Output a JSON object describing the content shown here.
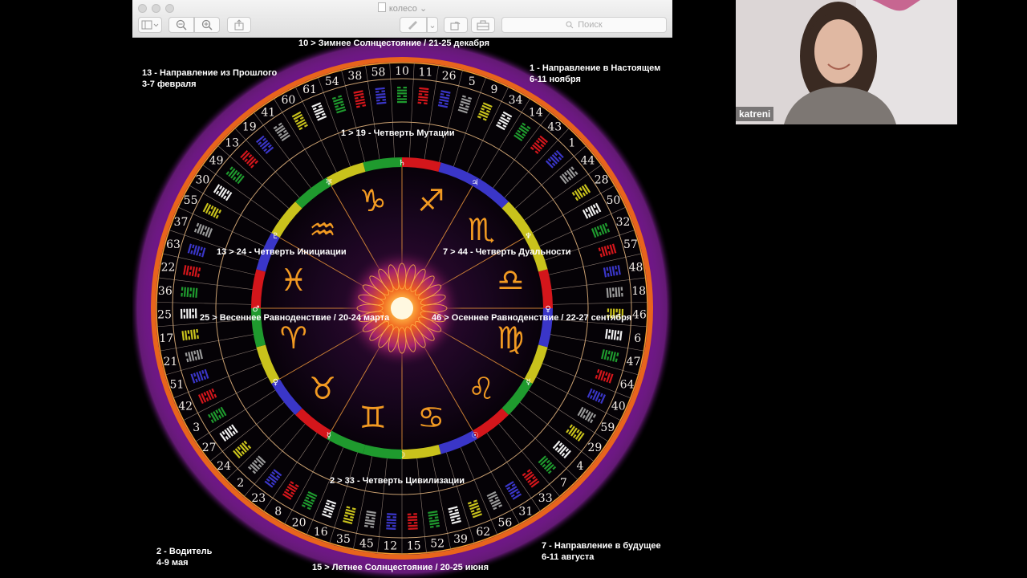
{
  "window": {
    "title": "колесо",
    "search_placeholder": "Поиск",
    "toolbar": {
      "sidebar_icon": "sidebar-icon",
      "zoom_out_icon": "zoom-out-icon",
      "zoom_in_icon": "zoom-in-icon",
      "share_icon": "share-icon",
      "markup_icon": "pen-icon",
      "rotate_icon": "rotate-icon",
      "toolbox_icon": "toolbox-icon"
    }
  },
  "wheel": {
    "labels": {
      "top": "10 > Зимнее Солнцестояние /  21-25 декабря",
      "bottom": "15 > Летнее Солнцестояние /  20-25 июня",
      "left_mid": "25 > Весеннее Равноденствие /  20-24 марта",
      "right_mid": "46 > Осеннее Равноденствие / 22-27 сентября",
      "quarter_top": "1 > 19 - Четверть Мутации",
      "quarter_left": "13 > 24 - Четверть Инициации",
      "quarter_right": "7 > 44 - Четверть Дуальности",
      "quarter_bottom": "2 > 33 - Четверть Цивилизации",
      "corner_tl_1": "13 - Направление из Прошлого",
      "corner_tl_2": "3-7 февраля",
      "corner_tr_1": "1 - Направление в Настоящем",
      "corner_tr_2": "6-11 ноября",
      "corner_bl_1": "2 - Водитель",
      "corner_bl_2": "4-9 мая",
      "corner_br_1": "7 - Направление в будущее",
      "corner_br_2": "6-11 августа"
    },
    "gate_numbers": [
      "10",
      "11",
      "26",
      "5",
      "9",
      "34",
      "14",
      "43",
      "1",
      "44",
      "28",
      "50",
      "32",
      "57",
      "48",
      "18",
      "46",
      "6",
      "47",
      "64",
      "40",
      "59",
      "29",
      "4",
      "7",
      "33",
      "31",
      "56",
      "62",
      "39",
      "52",
      "15",
      "12",
      "45",
      "35",
      "16",
      "20",
      "8",
      "23",
      "2",
      "24",
      "27",
      "3",
      "42",
      "51",
      "21",
      "17",
      "25",
      "36",
      "22",
      "63",
      "37",
      "55",
      "30",
      "49",
      "13",
      "19",
      "41",
      "60",
      "61",
      "54",
      "38",
      "58"
    ],
    "zodiac_signs": [
      "♑",
      "♐",
      "♏",
      "♎",
      "♍",
      "♌",
      "♋",
      "♊",
      "♉",
      "♈",
      "♓",
      "♒"
    ],
    "planet_glyphs": [
      "♄",
      "♃",
      "♆",
      "♀",
      "☿",
      "☉",
      "☽",
      "☿",
      "♀",
      "♂",
      "♇",
      "♅"
    ],
    "colors": {
      "green": "#1f9a2e",
      "red": "#d4161b",
      "blue": "#3a36c8",
      "yellow": "#c9c21c",
      "orange_ring": "#f08a18",
      "purple_glow": "#8a1fa8",
      "sign_gold": "#f29a22"
    }
  },
  "participant": {
    "name": "katreni"
  }
}
